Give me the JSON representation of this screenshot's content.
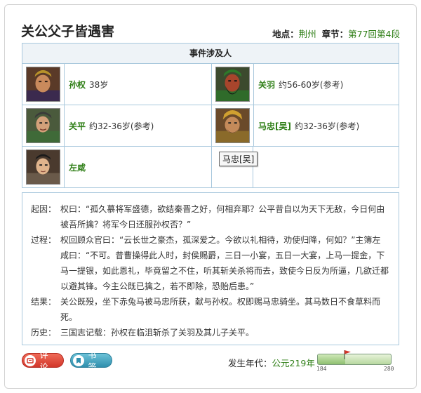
{
  "title": "关公父子皆遇害",
  "location": {
    "place_label": "地点：",
    "place": "荆州",
    "chapter_label": "章节：",
    "chapter": "第77回第4段"
  },
  "people": {
    "heading": "事件涉及人",
    "list": [
      {
        "name": "孙权",
        "age": "38岁"
      },
      {
        "name": "关羽",
        "age": "约56-60岁(参考)"
      },
      {
        "name": "关平",
        "age": "约32-36岁(参考)"
      },
      {
        "name": "马忠[吴]",
        "age": "约32-36岁(参考)"
      },
      {
        "name": "左咸",
        "age": ""
      }
    ],
    "tooltip": "马忠[吴]"
  },
  "event": {
    "cause_label": "起因：",
    "cause": "权曰：“孤久慕将军盛德，欲结秦晋之好，何相弃耶？公平昔自以为天下无敌，今日何由被吾所擒？将军今日还服孙权否？”",
    "process_label": "过程：",
    "process": "权回顾众官曰：“云长世之豪杰，孤深爱之。今欲以礼相待，劝使归降，何如？”主簿左咸曰：“不可。昔曹操得此人时，封侯赐爵，三日一小宴，五日一大宴，上马一提金，下马一提银，如此恩礼，毕竟留之不住，听其斩关杀将而去，致使今日反为所逼，几欲迁都以避其锋。今主公既已擒之，若不即除，恐贻后患。”",
    "result_label": "结果：",
    "result": "关公既殁，坐下赤兔马被马忠所获，献与孙权。权即赐马忠骑坐。其马数日不食草料而死。",
    "history_label": "历史：",
    "history": "三国志记载：孙权在临沮斩杀了关羽及其儿子关平。"
  },
  "buttons": {
    "review": "评论",
    "bookmark": "书签"
  },
  "era": {
    "label": "发生年代：",
    "value": "公元219年"
  },
  "timeline": {
    "min": "184",
    "max": "280",
    "current": 219
  },
  "colors": {
    "accent_green": "#2f7f17",
    "border_blue": "#a9c8dd",
    "review_red": "#d2362a",
    "bookmark_teal": "#2f8fad"
  }
}
